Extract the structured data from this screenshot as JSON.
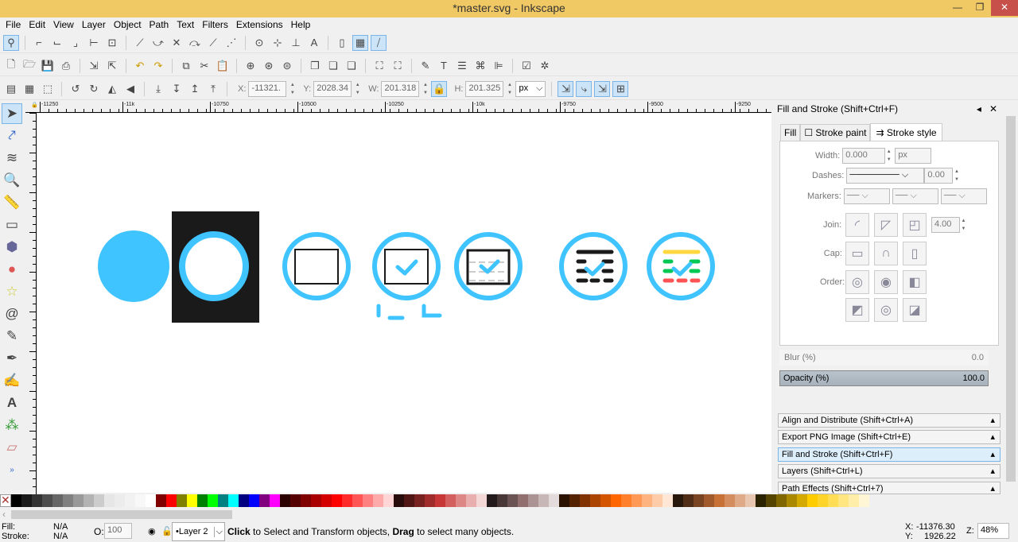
{
  "window": {
    "title": "*master.svg - Inkscape",
    "min": "—",
    "max": "❐",
    "close": "✕"
  },
  "menu": [
    "File",
    "Edit",
    "View",
    "Layer",
    "Object",
    "Path",
    "Text",
    "Filters",
    "Extensions",
    "Help"
  ],
  "controls": {
    "x_label": "X:",
    "x": "-11321.",
    "y_label": "Y:",
    "y": "2028.34",
    "w_label": "W:",
    "w": "201.318",
    "h_label": "H:",
    "h": "201.325",
    "unit": "px"
  },
  "ruler": [
    "-11250",
    "-11k",
    "-10750",
    "-10500",
    "-10250",
    "-10k",
    "-9750",
    "-9500",
    "-9250"
  ],
  "panel": {
    "title": "Fill and Stroke (Shift+Ctrl+F)",
    "tabs": [
      "Fill",
      "Stroke paint",
      "Stroke style"
    ],
    "width_label": "Width:",
    "width": "0.000",
    "width_unit": "px",
    "dashes_label": "Dashes:",
    "dash_offset": "0.00",
    "markers_label": "Markers:",
    "join_label": "Join:",
    "miter": "4.00",
    "cap_label": "Cap:",
    "order_label": "Order:",
    "blur_label": "Blur (%)",
    "blur": "0.0",
    "opacity_label": "Opacity (%)",
    "opacity": "100.0",
    "opacity_value": 100,
    "docks": [
      "Align and Distribute (Shift+Ctrl+A)",
      "Export PNG Image (Shift+Ctrl+E)",
      "Fill and Stroke (Shift+Ctrl+F)",
      "Layers (Shift+Ctrl+L)",
      "Path Effects  (Shift+Ctrl+7)"
    ]
  },
  "status": {
    "fill_label": "Fill:",
    "fill": "N/A",
    "stroke_label": "Stroke:",
    "stroke": "N/A",
    "o_label": "O:",
    "opacity": "100",
    "layer": "•Layer 2",
    "msg_b1": "Click",
    "msg_1": " to Select and Transform objects, ",
    "msg_b2": "Drag",
    "msg_2": " to select many objects.",
    "cx_label": "X:",
    "cx": "-11376.30",
    "cy_label": "Y:",
    "cy": "1926.22",
    "z_label": "Z:",
    "zoom": "48%"
  },
  "colors": {
    "accent": "#40c4ff",
    "yellow": "#ffd740",
    "green": "#00c853",
    "red": "#ff5252",
    "dark": "#1a1a1a",
    "title": "#f0c864"
  },
  "swatches": [
    "#000000",
    "#1a1a1a",
    "#333333",
    "#4d4d4d",
    "#666666",
    "#808080",
    "#999999",
    "#b3b3b3",
    "#cccccc",
    "#e6e6e6",
    "#ececec",
    "#f2f2f2",
    "#f8f8f8",
    "#ffffff",
    "#800000",
    "#ff0000",
    "#808000",
    "#ffff00",
    "#008000",
    "#00ff00",
    "#008080",
    "#00ffff",
    "#000080",
    "#0000ff",
    "#800080",
    "#ff00ff",
    "#2b0000",
    "#550000",
    "#800000",
    "#aa0000",
    "#d40000",
    "#ff0000",
    "#ff2a2a",
    "#ff5555",
    "#ff8080",
    "#ffaaaa",
    "#ffd5d5",
    "#280b0b",
    "#501616",
    "#782121",
    "#a02c2c",
    "#c83737",
    "#d35f5f",
    "#de8787",
    "#e9afaf",
    "#f4d7d7",
    "#241c1c",
    "#483737",
    "#6c5353",
    "#916f6f",
    "#ac9393",
    "#c8b7b7",
    "#e3dbdb",
    "#2b1100",
    "#552200",
    "#803300",
    "#aa4400",
    "#d45500",
    "#ff6600",
    "#ff7f2a",
    "#ff9955",
    "#ffb380",
    "#ffccaa",
    "#ffe6d5",
    "#28170b",
    "#502d16",
    "#784421",
    "#a05a2c",
    "#c87137",
    "#d38d5f",
    "#deaa87",
    "#e9c6af",
    "#2b2200",
    "#554400",
    "#806600",
    "#aa8800",
    "#d4aa00",
    "#ffcc00",
    "#ffd42a",
    "#ffdd55",
    "#ffe680",
    "#ffeeaa",
    "#fff6d5"
  ]
}
